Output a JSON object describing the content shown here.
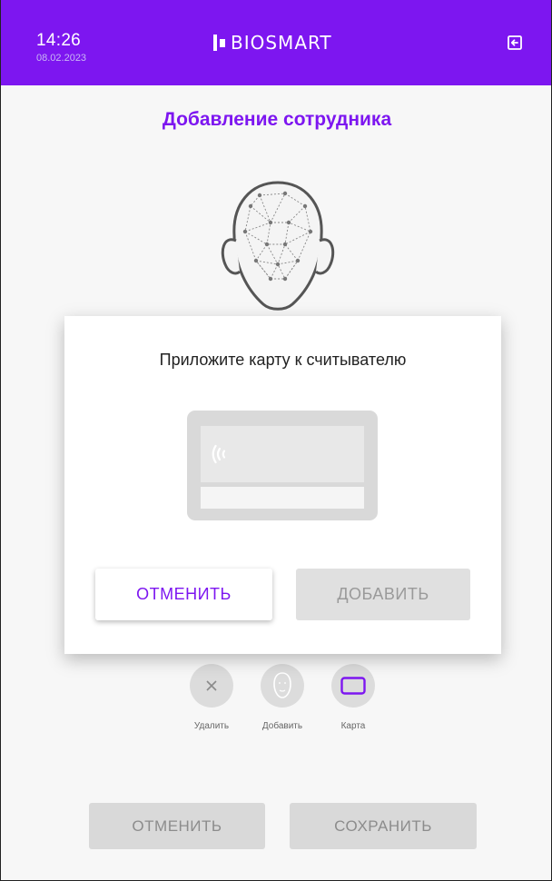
{
  "header": {
    "time": "14:26",
    "date": "08.02.2023",
    "logo_text": "BIOSMART",
    "exit_icon": "exit-icon",
    "background": "#7d16f0"
  },
  "page": {
    "title": "Добавление сотрудника"
  },
  "identifiers": {
    "delete_label": "Удалить",
    "add_face_label": "Добавить",
    "card_label": "Карта"
  },
  "footer": {
    "cancel_label": "ОТМЕНИТЬ",
    "save_label": "СОХРАНИТЬ"
  },
  "dialog": {
    "message": "Приложите карту к считывателю",
    "cancel_label": "ОТМЕНИТЬ",
    "add_label": "ДОБАВИТЬ",
    "card_icon": "nfc-card-icon"
  },
  "colors": {
    "accent": "#7d16f0",
    "disabled": "#d9d9d9"
  }
}
